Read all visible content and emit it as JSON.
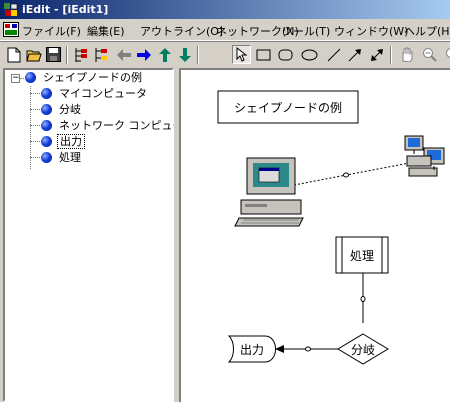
{
  "window": {
    "title": "iEdit - [iEdit1]"
  },
  "menu": {
    "items": [
      "ファイル(F)",
      "編集(E)",
      "アウトライン(O)",
      "ネットワーク(N)",
      "ツール(T)",
      "ウィンドウ(W)",
      "ヘルプ(H)"
    ]
  },
  "toolbar": {
    "icons": [
      "new-file-icon",
      "open-folder-icon",
      "save-icon",
      "indent-icon",
      "outdent-icon",
      "arrow-left-icon",
      "arrow-right-icon",
      "arrow-up-icon",
      "arrow-down-icon",
      "pointer-icon",
      "rectangle-icon",
      "rounded-rect-icon",
      "ellipse-icon",
      "line-icon",
      "arrow-line-icon",
      "bidirectional-arrow-icon",
      "hand-icon",
      "zoom-icon"
    ],
    "selected_tool": "pointer-icon"
  },
  "tree": {
    "root": "シェイプノードの例",
    "children": [
      "マイコンピュータ",
      "分岐",
      "ネットワーク コンピュータ",
      "出力",
      "処理"
    ],
    "selected": "出力"
  },
  "canvas": {
    "title_box": "シェイプノードの例",
    "process": "処理",
    "branch": "分岐",
    "output": "出力"
  }
}
